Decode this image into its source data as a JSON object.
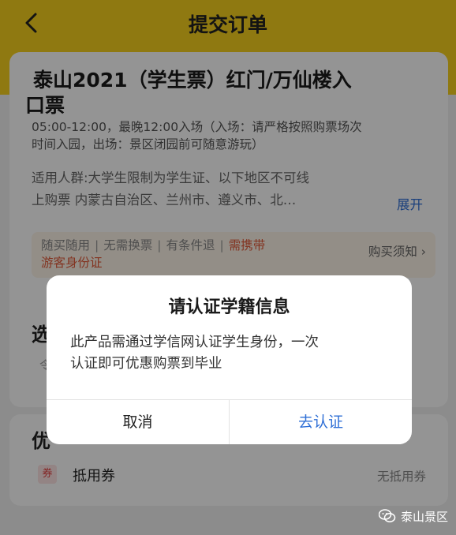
{
  "header": {
    "title": "提交订单"
  },
  "ticket": {
    "title_line1": "泰山2021（学生票）红门/万仙楼入",
    "title_line2": "口票",
    "time_line1": "05:00-12:00，最晚12:00入场（入场：请严格按照购票场次",
    "time_line2": "时间入园，出场：景区闭园前可随意游玩）",
    "suitable_line1": "适用人群:大学生限制为学生证、以下地区不可线",
    "suitable_line2": "上购票 内蒙古自治区、兰州市、遵义市、北…",
    "expand_label": "展开",
    "tags": {
      "tag1": "随买随用",
      "tag2": "无需换票",
      "tag3": "有条件退",
      "tag4a": "需携带",
      "tag4b": "游客身份证",
      "separator": "|"
    },
    "buy_notice": "购买须知"
  },
  "section2": {
    "head_partial": "选",
    "sub_partial": "令"
  },
  "section3": {
    "head_partial": "优",
    "coupon_badge": "券",
    "coupon_label": "抵用券",
    "coupon_value": "无抵用券"
  },
  "dialog": {
    "title": "请认证学籍信息",
    "body_line1": "此产品需通过学信网认证学生身份，一次",
    "body_line2": "认证即可优惠购票到毕业",
    "cancel_label": "取消",
    "confirm_label": "去认证"
  },
  "watermark": {
    "text": "泰山景区"
  },
  "colors": {
    "header_bg": "#f7d11e",
    "link_blue": "#2f6fd6",
    "tag_red": "#e25a3a"
  }
}
